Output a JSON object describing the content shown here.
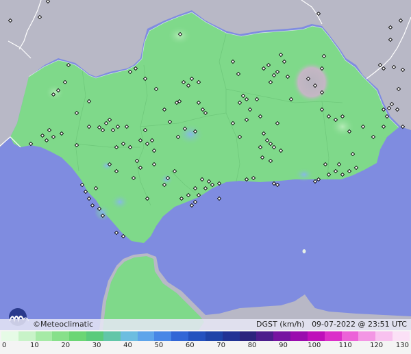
{
  "map": {
    "credit": "©Meteoclimatic",
    "variable": "DGST (km/h)",
    "timestamp": "09-07-2022 @ 23:51 UTC",
    "station_icon": "station-marker-icon",
    "logo_icon": "meteoclimatic-logo-icon"
  },
  "colors": {
    "sea": "#7f8ce0",
    "land_outside": "#b8b8c6",
    "region_fill": "#7fd98a",
    "border": "#ffffff"
  },
  "scale": {
    "labels": [
      "0",
      "10",
      "20",
      "30",
      "40",
      "50",
      "60",
      "70",
      "80",
      "90",
      "100",
      "110",
      "120",
      "130"
    ],
    "colors": [
      "#e6fbe6",
      "#c8f3c8",
      "#a6eaa6",
      "#87e08a",
      "#6bd674",
      "#5acb7b",
      "#62c6a8",
      "#6cbde0",
      "#5ea4ea",
      "#4886e6",
      "#3266d6",
      "#2452bf",
      "#1e44a8",
      "#213394",
      "#2c237d",
      "#4c1d8c",
      "#7613a1",
      "#9a0cae",
      "#bf0fba",
      "#db2fc9",
      "#ec62d8",
      "#f396e4",
      "#f8c1ef",
      "#fbe0f6"
    ]
  }
}
